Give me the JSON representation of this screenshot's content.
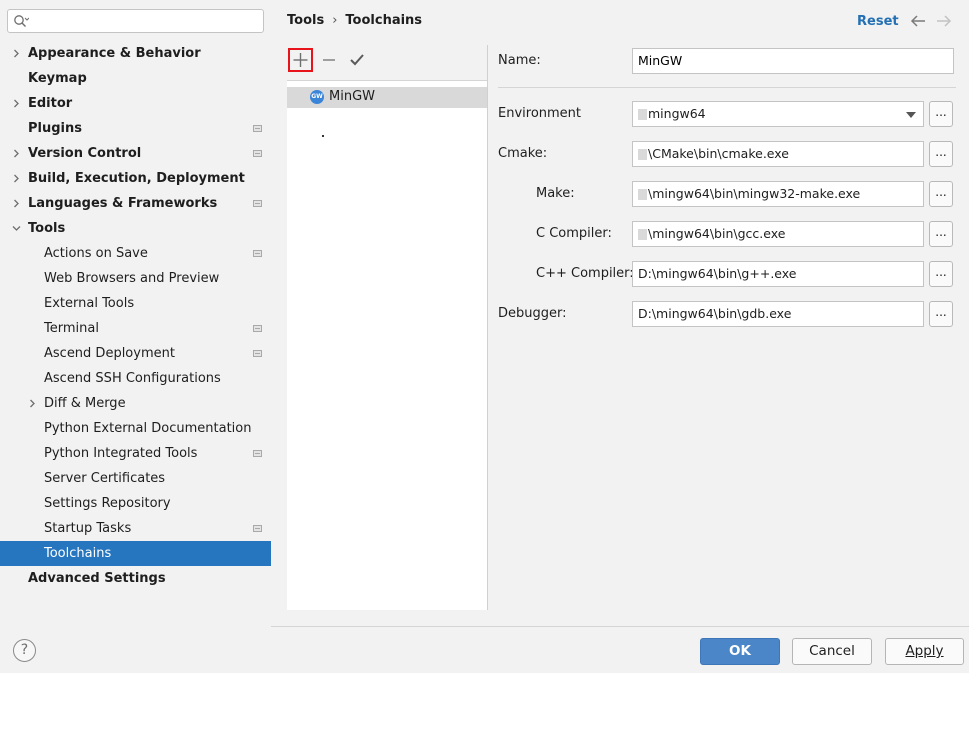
{
  "search": {
    "placeholder": "",
    "value": ""
  },
  "sidebar": {
    "items": [
      {
        "label": "Appearance & Behavior",
        "bold": true,
        "arrow": "right",
        "level": 0
      },
      {
        "label": "Keymap",
        "bold": true,
        "level": 0
      },
      {
        "label": "Editor",
        "bold": true,
        "arrow": "right",
        "level": 0
      },
      {
        "label": "Plugins",
        "bold": true,
        "level": 0,
        "project": true
      },
      {
        "label": "Version Control",
        "bold": true,
        "arrow": "right",
        "level": 0,
        "project": true
      },
      {
        "label": "Build, Execution, Deployment",
        "bold": true,
        "arrow": "right",
        "level": 0
      },
      {
        "label": "Languages & Frameworks",
        "bold": true,
        "arrow": "right",
        "level": 0,
        "project": true
      },
      {
        "label": "Tools",
        "bold": true,
        "arrow": "down",
        "level": 0
      },
      {
        "label": "Actions on Save",
        "level": 1,
        "project": true
      },
      {
        "label": "Web Browsers and Preview",
        "level": 1
      },
      {
        "label": "External Tools",
        "level": 1
      },
      {
        "label": "Terminal",
        "level": 1,
        "project": true
      },
      {
        "label": "Ascend Deployment",
        "level": 1,
        "project": true
      },
      {
        "label": "Ascend SSH Configurations",
        "level": 1
      },
      {
        "label": "Diff & Merge",
        "level": 1,
        "arrow": "right"
      },
      {
        "label": "Python External Documentation",
        "level": 1
      },
      {
        "label": "Python Integrated Tools",
        "level": 1,
        "project": true
      },
      {
        "label": "Server Certificates",
        "level": 1
      },
      {
        "label": "Settings Repository",
        "level": 1
      },
      {
        "label": "Startup Tasks",
        "level": 1,
        "project": true
      },
      {
        "label": "Toolchains",
        "level": 1,
        "selected": true
      },
      {
        "label": "Advanced Settings",
        "bold": true,
        "level": 0
      }
    ]
  },
  "header": {
    "breadcrumb": [
      "Tools",
      "Toolchains"
    ],
    "separator": "›",
    "reset_label": "Reset"
  },
  "toolchains": {
    "items": [
      {
        "label": "MinGW",
        "icon_text": "GW"
      }
    ]
  },
  "form": {
    "name_label": "Name:",
    "name_value": "MinGW",
    "environment_label": "Environment",
    "environment_value": "mingw64",
    "cmake_label": "Cmake:",
    "cmake_value": "\\CMake\\bin\\cmake.exe",
    "make_label": "Make:",
    "make_value": "\\mingw64\\bin\\mingw32-make.exe",
    "c_compiler_label": "C Compiler:",
    "c_compiler_value": "\\mingw64\\bin\\gcc.exe",
    "cpp_compiler_label": "C++ Compiler:",
    "cpp_compiler_value": "D:\\mingw64\\bin\\g++.exe",
    "debugger_label": "Debugger:",
    "debugger_value": "D:\\mingw64\\bin\\gdb.exe",
    "browse_label": "..."
  },
  "footer": {
    "help_label": "?",
    "ok_label": "OK",
    "cancel_label": "Cancel",
    "apply_label": "Apply"
  },
  "colors": {
    "selection": "#2675bf",
    "ok_button": "#4a86c8",
    "link": "#2470b3",
    "add_highlight": "#e8141c"
  }
}
